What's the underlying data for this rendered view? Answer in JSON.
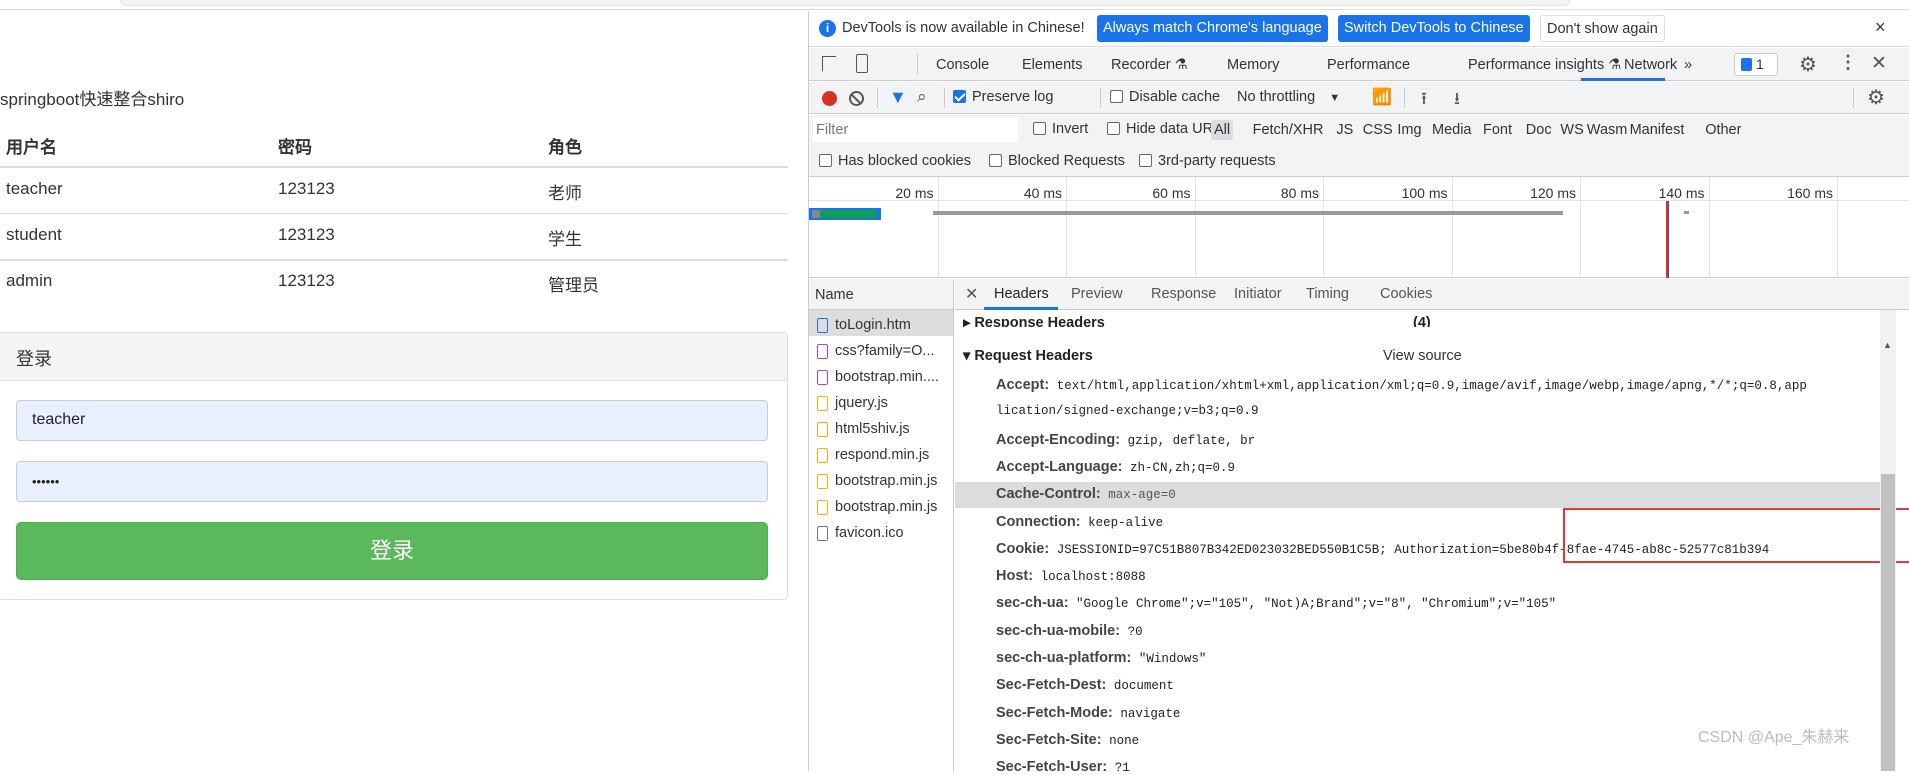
{
  "page": {
    "title": "springboot快速整合shiro",
    "table": {
      "headers": [
        "用户名",
        "密码",
        "角色"
      ],
      "rows": [
        [
          "teacher",
          "123123",
          "老师"
        ],
        [
          "student",
          "123123",
          "学生"
        ],
        [
          "admin",
          "123123",
          "管理员"
        ]
      ]
    },
    "login": {
      "panel_title": "登录",
      "username_value": "teacher",
      "password_value": "••••••",
      "submit_label": "登录"
    }
  },
  "devtools": {
    "infobar": {
      "message": "DevTools is now available in Chinese!",
      "btn_match": "Always match Chrome's language",
      "btn_switch": "Switch DevTools to Chinese",
      "btn_dismiss": "Don't show again",
      "close": "×"
    },
    "tabs": [
      "Console",
      "Elements",
      "Recorder ⚗",
      "Memory",
      "Performance",
      "Performance insights ⚗",
      "Network",
      "»"
    ],
    "active_tab": "Network",
    "issues_count": "1",
    "toolbar": {
      "preserve_log": "Preserve log",
      "preserve_log_checked": true,
      "disable_cache": "Disable cache",
      "throttling": "No throttling"
    },
    "filter": {
      "placeholder": "Filter",
      "invert": "Invert",
      "hide_data_urls": "Hide data URLs",
      "types": [
        "All",
        "Fetch/XHR",
        "JS",
        "CSS",
        "Img",
        "Media",
        "Font",
        "Doc",
        "WS",
        "Wasm",
        "Manifest",
        "Other"
      ]
    },
    "row3": {
      "blocked_cookies": "Has blocked cookies",
      "blocked_requests": "Blocked Requests",
      "third_party": "3rd-party requests"
    },
    "timeline_ticks": [
      "20 ms",
      "40 ms",
      "60 ms",
      "80 ms",
      "100 ms",
      "120 ms",
      "140 ms",
      "160 ms"
    ],
    "name_header": "Name",
    "requests": [
      {
        "name": "toLogin.htm",
        "type": "doc",
        "color": "#1a73e8"
      },
      {
        "name": "css?family=O...",
        "type": "css",
        "color": "#a142f4"
      },
      {
        "name": "bootstrap.min....",
        "type": "css",
        "color": "#a142f4"
      },
      {
        "name": "jquery.js",
        "type": "js",
        "color": "#f9ab00"
      },
      {
        "name": "html5shiv.js",
        "type": "js",
        "color": "#f9ab00"
      },
      {
        "name": "respond.min.js",
        "type": "js",
        "color": "#f9ab00"
      },
      {
        "name": "bootstrap.min.js",
        "type": "js",
        "color": "#f9ab00"
      },
      {
        "name": "bootstrap.min.js",
        "type": "js",
        "color": "#f9ab00"
      },
      {
        "name": "favicon.ico",
        "type": "other",
        "color": "#777777"
      }
    ],
    "detail_tabs": [
      "Headers",
      "Preview",
      "Response",
      "Initiator",
      "Timing",
      "Cookies"
    ],
    "response_headers": {
      "label": "Response Headers",
      "count": "(4)"
    },
    "request_headers": {
      "label": "Request Headers",
      "view_source": "View source",
      "items": [
        {
          "k": "Accept:",
          "v": "text/html,application/xhtml+xml,application/xml;q=0.9,image/avif,image/webp,image/apng,*/*;q=0.8,app"
        },
        {
          "k": "",
          "v": "lication/signed-exchange;v=b3;q=0.9"
        },
        {
          "k": "Accept-Encoding:",
          "v": "gzip, deflate, br"
        },
        {
          "k": "Accept-Language:",
          "v": "zh-CN,zh;q=0.9"
        },
        {
          "k": "Cache-Control:",
          "v": "max-age=0"
        },
        {
          "k": "Connection:",
          "v": "keep-alive"
        },
        {
          "k": "Cookie:",
          "v": "JSESSIONID=97C51B807B342ED023032BED550B1C5B; Authorization=5be80b4f-8fae-4745-ab8c-52577c81b394"
        },
        {
          "k": "Host:",
          "v": "localhost:8088"
        },
        {
          "k": "sec-ch-ua:",
          "v": "\"Google Chrome\";v=\"105\", \"Not)A;Brand\";v=\"8\", \"Chromium\";v=\"105\""
        },
        {
          "k": "sec-ch-ua-mobile:",
          "v": "?0"
        },
        {
          "k": "sec-ch-ua-platform:",
          "v": "\"Windows\""
        },
        {
          "k": "Sec-Fetch-Dest:",
          "v": "document"
        },
        {
          "k": "Sec-Fetch-Mode:",
          "v": "navigate"
        },
        {
          "k": "Sec-Fetch-Site:",
          "v": "none"
        },
        {
          "k": "Sec-Fetch-User:",
          "v": "?1"
        }
      ]
    }
  },
  "watermark": "CSDN @Ape_朱赫来",
  "colors": {
    "accent": "#1a73e8",
    "success": "#5cb85c",
    "highlight_box": "#e53935",
    "record": "#d93025"
  }
}
